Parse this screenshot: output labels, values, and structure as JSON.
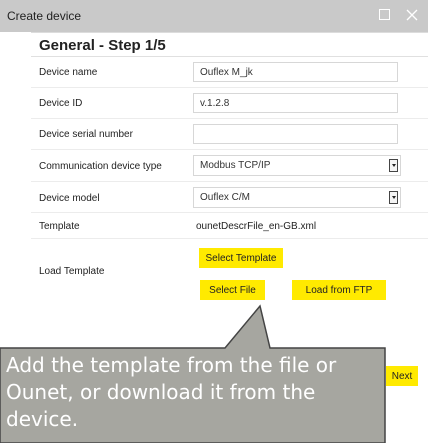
{
  "window": {
    "title": "Create device"
  },
  "header": {
    "title": "General - Step 1/5"
  },
  "form": {
    "device_name": {
      "label": "Device name",
      "value": "Ouflex M_jk"
    },
    "device_id": {
      "label": "Device ID",
      "value": "v.1.2.8"
    },
    "serial_number": {
      "label": "Device serial number",
      "value": ""
    },
    "communication_type": {
      "label": "Communication device type",
      "value": "Modbus TCP/IP"
    },
    "device_model": {
      "label": "Device model",
      "value": "Ouflex C/M"
    },
    "template": {
      "label": "Template",
      "value": "ounetDescrFile_en-GB.xml"
    },
    "load_template": {
      "label": "Load Template"
    }
  },
  "buttons": {
    "select_template": "Select Template",
    "select_file": "Select File",
    "load_from_ftp": "Load from FTP",
    "next": "Next"
  },
  "callout": {
    "text": "Add the template from the file or Ounet, or download it from the device."
  },
  "colors": {
    "button_yellow": "#ffea00",
    "titlebar": "#c9c9c9",
    "callout_fill": "#a6a6a0",
    "callout_border": "#444444"
  }
}
